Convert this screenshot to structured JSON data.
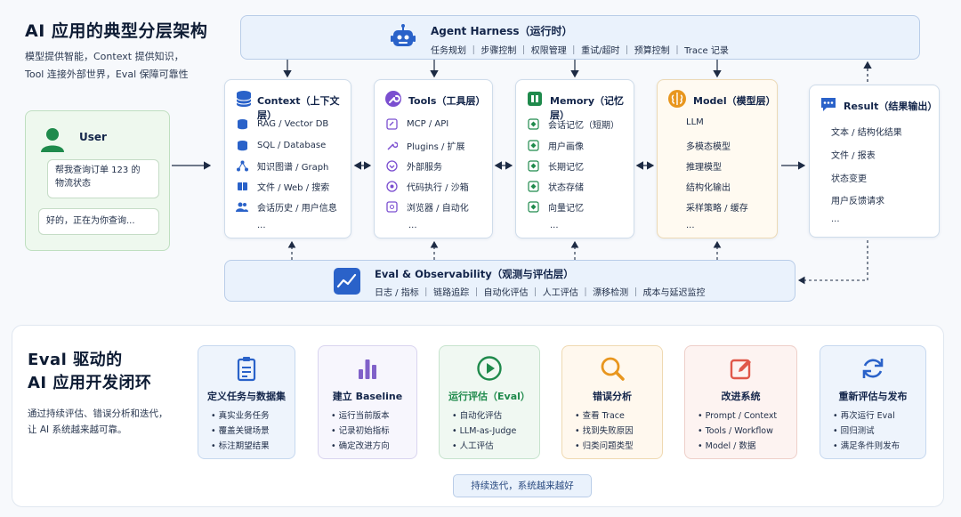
{
  "top": {
    "title": "AI 应用的典型分层架构",
    "subtitle_1": "模型提供智能，Context 提供知识，",
    "subtitle_2": "Tool 连接外部世界，Eval 保障可靠性"
  },
  "harness": {
    "title": "Agent Harness（运行时）",
    "items": "任务规划 ｜ 步骤控制 ｜ 权限管理 ｜ 重试/超时 ｜ 预算控制 ｜ Trace 记录"
  },
  "user": {
    "label": "User",
    "query_1": "帮我查询订单 123 的",
    "query_2": "物流状态",
    "reply": "好的，正在为你查询..."
  },
  "context": {
    "title": "Context（上下文层）",
    "items": [
      "RAG / Vector DB",
      "SQL / Database",
      "知识图谱 / Graph",
      "文件 / Web / 搜索",
      "会话历史 / 用户信息",
      "..."
    ]
  },
  "tools": {
    "title": "Tools（工具层）",
    "items": [
      "MCP / API",
      "Plugins / 扩展",
      "外部服务",
      "代码执行 / 沙箱",
      "浏览器 / 自动化",
      "..."
    ]
  },
  "memory": {
    "title": "Memory（记忆层）",
    "items": [
      "会话记忆（短期）",
      "用户画像",
      "长期记忆",
      "状态存储",
      "向量记忆",
      "..."
    ]
  },
  "model": {
    "title": "Model（模型层）",
    "items": [
      "LLM",
      "多模态模型",
      "推理模型",
      "结构化输出",
      "采样策略 / 缓存",
      "..."
    ]
  },
  "result": {
    "title": "Result（结果输出）",
    "items": [
      "文本 / 结构化结果",
      "文件 / 报表",
      "状态变更",
      "用户反馈请求",
      "..."
    ]
  },
  "eval_bar": {
    "title": "Eval & Observability（观测与评估层）",
    "items": "日志 / 指标 ｜ 链路追踪 ｜ 自动化评估 ｜ 人工评估 ｜ 漂移检测 ｜ 成本与延迟监控"
  },
  "loop": {
    "title_1": "Eval 驱动的",
    "title_2": "AI 应用开发闭环",
    "desc_1": "通过持续评估、错误分析和迭代，",
    "desc_2": "让 AI 系统越来越可靠。",
    "steps": [
      {
        "title": "定义任务与数据集",
        "items": [
          "• 真实业务任务",
          "• 覆盖关键场景",
          "• 标注期望结果"
        ]
      },
      {
        "title": "建立 Baseline",
        "items": [
          "• 运行当前版本",
          "• 记录初始指标",
          "• 确定改进方向"
        ]
      },
      {
        "title": "运行评估（Eval）",
        "items": [
          "• 自动化评估",
          "• LLM-as-Judge",
          "• 人工评估"
        ]
      },
      {
        "title": "错误分析",
        "items": [
          "• 查看 Trace",
          "• 找到失败原因",
          "• 归类问题类型"
        ]
      },
      {
        "title": "改进系统",
        "items": [
          "• Prompt / Context",
          "• Tools / Workflow",
          "• Model / 数据"
        ]
      },
      {
        "title": "重新评估与发布",
        "items": [
          "• 再次运行 Eval",
          "• 回归测试",
          "• 满足条件则发布"
        ]
      }
    ],
    "loop_label": "持续迭代，系统越来越好"
  }
}
